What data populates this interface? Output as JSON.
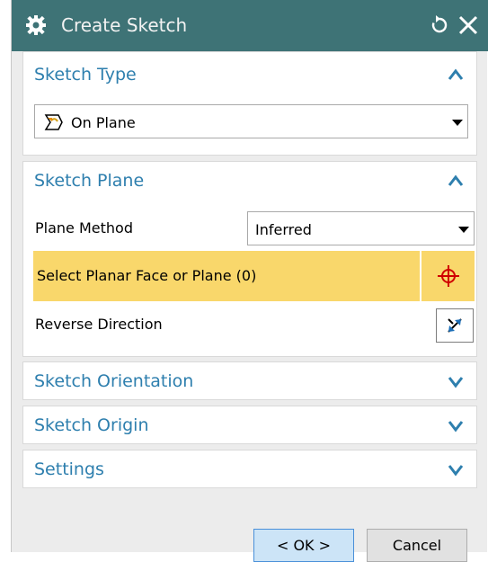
{
  "window": {
    "title": "Create Sketch"
  },
  "sketch_type": {
    "title": "Sketch Type",
    "selected": "On Plane"
  },
  "sketch_plane": {
    "title": "Sketch Plane",
    "plane_method_label": "Plane Method",
    "plane_method_value": "Inferred",
    "select_label": "Select Planar Face or Plane (0)",
    "reverse_label": "Reverse Direction"
  },
  "collapsed_groups": {
    "orientation": "Sketch Orientation",
    "origin": "Sketch Origin",
    "settings": "Settings"
  },
  "buttons": {
    "ok": "< OK >",
    "cancel": "Cancel"
  },
  "colors": {
    "titlebar": "#3e7376",
    "group_title": "#2e7fae",
    "highlight": "#f9d76b",
    "ok_button": "#cce4f7"
  }
}
